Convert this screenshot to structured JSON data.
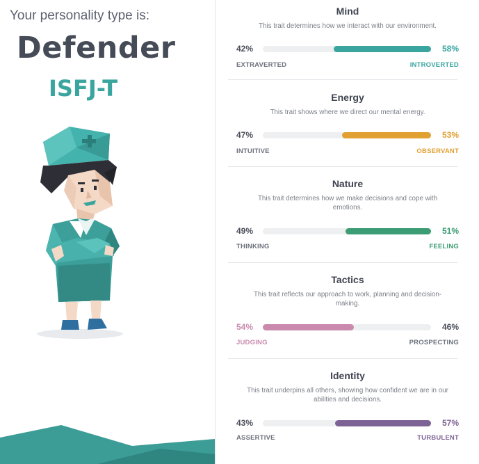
{
  "profile": {
    "intro": "Your personality type is:",
    "type_name": "Defender",
    "type_code": "ISFJ-T"
  },
  "colors": {
    "teal": "#3aa59f",
    "gold": "#e0a032",
    "green": "#3c9c73",
    "pink": "#c98aad",
    "purple": "#7d6295",
    "dark_text": "#4a4f5a",
    "neutral_label": "#6c717c"
  },
  "traits": [
    {
      "title": "Mind",
      "description": "This trait determines how we interact with our environment.",
      "left_pct": "42%",
      "right_pct": "58%",
      "left_label": "EXTRAVERTED",
      "right_label": "INTROVERTED",
      "dominant": "right",
      "value": 58,
      "color": "#3aa59f"
    },
    {
      "title": "Energy",
      "description": "This trait shows where we direct our mental energy.",
      "left_pct": "47%",
      "right_pct": "53%",
      "left_label": "INTUITIVE",
      "right_label": "OBSERVANT",
      "dominant": "right",
      "value": 53,
      "color": "#e0a032"
    },
    {
      "title": "Nature",
      "description": "This trait determines how we make decisions and cope with emotions.",
      "left_pct": "49%",
      "right_pct": "51%",
      "left_label": "THINKING",
      "right_label": "FEELING",
      "dominant": "right",
      "value": 51,
      "color": "#3c9c73"
    },
    {
      "title": "Tactics",
      "description": "This trait reflects our approach to work, planning and decision-making.",
      "left_pct": "54%",
      "right_pct": "46%",
      "left_label": "JUDGING",
      "right_label": "PROSPECTING",
      "dominant": "left",
      "value": 54,
      "color": "#c98aad"
    },
    {
      "title": "Identity",
      "description": "This trait underpins all others, showing how confident we are in our abilities and decisions.",
      "left_pct": "43%",
      "right_pct": "57%",
      "left_label": "ASSERTIVE",
      "right_label": "TURBULENT",
      "dominant": "right",
      "value": 57,
      "color": "#7d6295"
    }
  ],
  "illustration": {
    "icon": "defender-character-illustration"
  }
}
